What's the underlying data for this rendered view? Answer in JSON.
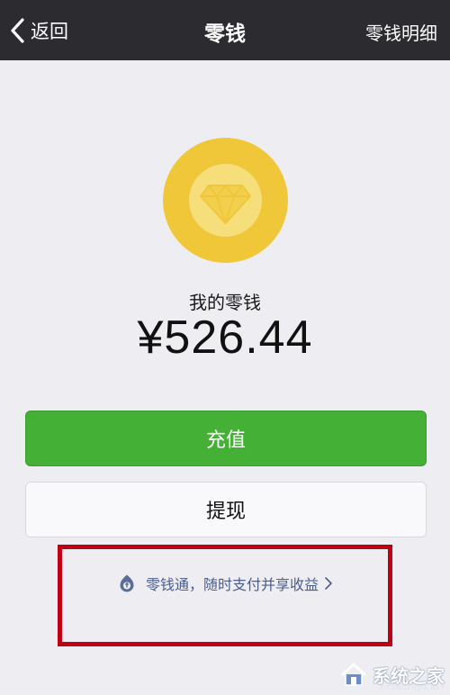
{
  "navbar": {
    "back_label": "返回",
    "title": "零钱",
    "right_label": "零钱明细"
  },
  "wallet": {
    "label": "我的零钱",
    "amount": "¥526.44"
  },
  "buttons": {
    "recharge": "充值",
    "withdraw": "提现"
  },
  "promo_link": {
    "text": "零钱通，随时支付并享收益",
    "chevron": "›"
  },
  "watermark": {
    "brand": "系统之家",
    "site": "XITONGZHIJIA.NET"
  },
  "colors": {
    "navbar_bg": "#2b2b30",
    "page_bg": "#eeeef2",
    "coin_outer": "#f1c73a",
    "coin_inner": "#f6de7a",
    "recharge_green": "#44b035",
    "link_blue": "#4a5d8c",
    "highlight_red": "#c00012"
  },
  "icons": {
    "back": "chevron-left-icon",
    "coin": "diamond-icon",
    "promo": "lingqiantong-icon",
    "promo_chevron": "chevron-right-icon"
  }
}
